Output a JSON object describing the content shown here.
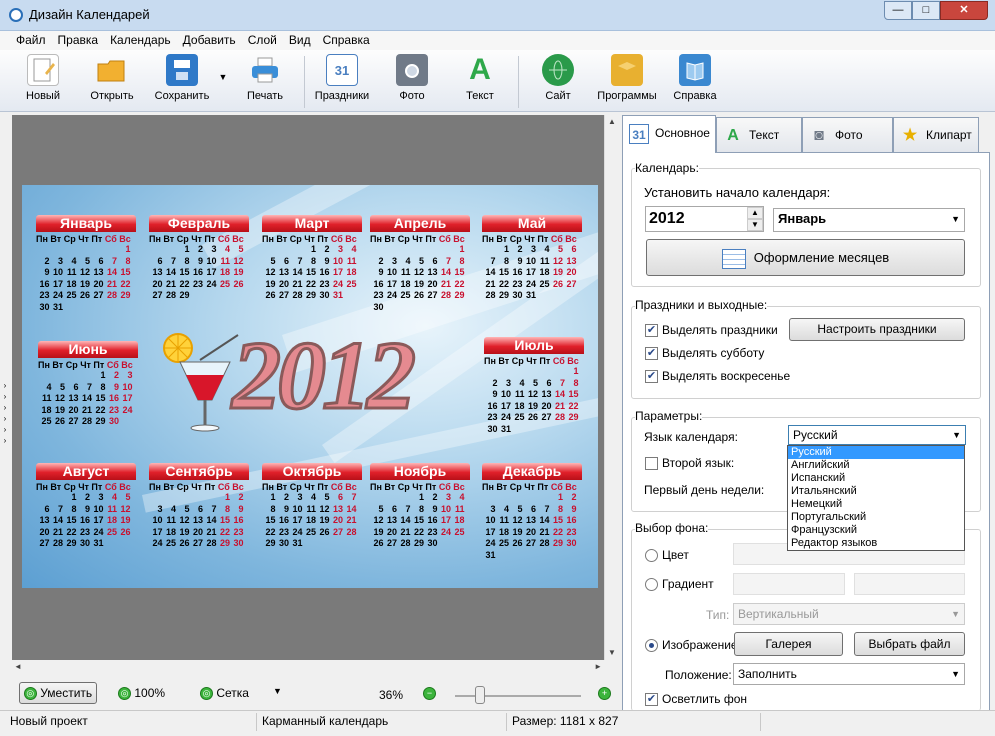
{
  "window": {
    "title": "Дизайн Календарей",
    "min": "—",
    "max": "□",
    "close": "✕"
  },
  "menu": [
    "Файл",
    "Правка",
    "Календарь",
    "Добавить",
    "Слой",
    "Вид",
    "Справка"
  ],
  "toolbar": [
    {
      "label": "Новый",
      "icon": "new-doc-icon",
      "color": "#e9b44c"
    },
    {
      "label": "Открыть",
      "icon": "folder-icon",
      "color": "#f2b030"
    },
    {
      "label": "Сохранить",
      "icon": "floppy-icon",
      "color": "#2f79c8"
    },
    {
      "label": "Печать",
      "icon": "printer-icon",
      "color": "#3a8ed8"
    },
    {
      "label": "Праздники",
      "icon": "calendar-icon",
      "color": "#4a7fc0"
    },
    {
      "label": "Фото",
      "icon": "camera-icon",
      "color": "#707a88"
    },
    {
      "label": "Текст",
      "icon": "text-a-icon",
      "color": "#2ea84a"
    },
    {
      "label": "Сайт",
      "icon": "globe-icon",
      "color": "#2a9a4a"
    },
    {
      "label": "Программы",
      "icon": "box-icon",
      "color": "#e8b030"
    },
    {
      "label": "Справка",
      "icon": "book-icon",
      "color": "#3a88d0"
    }
  ],
  "calendar": {
    "year": "2012",
    "weekdays_plain": "Пн Вт Ср Чт Пт ",
    "weekdays_red": "Сб Вс",
    "months": [
      {
        "name": "Январь",
        "rows": [
          [
            "",
            "",
            "",
            "",
            "",
            "",
            "1"
          ],
          [
            "2",
            "3",
            "4",
            "5",
            "6",
            "7",
            "8"
          ],
          [
            "9",
            "10",
            "11",
            "12",
            "13",
            "14",
            "15"
          ],
          [
            "16",
            "17",
            "18",
            "19",
            "20",
            "21",
            "22"
          ],
          [
            "23",
            "24",
            "25",
            "26",
            "27",
            "28",
            "29"
          ],
          [
            "30",
            "31",
            "",
            "",
            "",
            "",
            ""
          ]
        ]
      },
      {
        "name": "Февраль",
        "rows": [
          [
            "",
            "",
            "1",
            "2",
            "3",
            "4",
            "5"
          ],
          [
            "6",
            "7",
            "8",
            "9",
            "10",
            "11",
            "12"
          ],
          [
            "13",
            "14",
            "15",
            "16",
            "17",
            "18",
            "19"
          ],
          [
            "20",
            "21",
            "22",
            "23",
            "24",
            "25",
            "26"
          ],
          [
            "27",
            "28",
            "29",
            "",
            "",
            "",
            ""
          ]
        ]
      },
      {
        "name": "Март",
        "rows": [
          [
            "",
            "",
            "",
            "1",
            "2",
            "3",
            "4"
          ],
          [
            "5",
            "6",
            "7",
            "8",
            "9",
            "10",
            "11"
          ],
          [
            "12",
            "13",
            "14",
            "15",
            "16",
            "17",
            "18"
          ],
          [
            "19",
            "20",
            "21",
            "22",
            "23",
            "24",
            "25"
          ],
          [
            "26",
            "27",
            "28",
            "29",
            "30",
            "31",
            ""
          ]
        ]
      },
      {
        "name": "Апрель",
        "rows": [
          [
            "",
            "",
            "",
            "",
            "",
            "",
            "1"
          ],
          [
            "2",
            "3",
            "4",
            "5",
            "6",
            "7",
            "8"
          ],
          [
            "9",
            "10",
            "11",
            "12",
            "13",
            "14",
            "15"
          ],
          [
            "16",
            "17",
            "18",
            "19",
            "20",
            "21",
            "22"
          ],
          [
            "23",
            "24",
            "25",
            "26",
            "27",
            "28",
            "29"
          ],
          [
            "30",
            "",
            "",
            "",
            "",
            "",
            ""
          ]
        ]
      },
      {
        "name": "Май",
        "rows": [
          [
            "",
            "1",
            "2",
            "3",
            "4",
            "5",
            "6"
          ],
          [
            "7",
            "8",
            "9",
            "10",
            "11",
            "12",
            "13"
          ],
          [
            "14",
            "15",
            "16",
            "17",
            "18",
            "19",
            "20"
          ],
          [
            "21",
            "22",
            "23",
            "24",
            "25",
            "26",
            "27"
          ],
          [
            "28",
            "29",
            "30",
            "31",
            "",
            "",
            ""
          ]
        ]
      },
      {
        "name": "Июнь",
        "rows": [
          [
            "",
            "",
            "",
            "",
            "1",
            "2",
            "3"
          ],
          [
            "4",
            "5",
            "6",
            "7",
            "8",
            "9",
            "10"
          ],
          [
            "11",
            "12",
            "13",
            "14",
            "15",
            "16",
            "17"
          ],
          [
            "18",
            "19",
            "20",
            "21",
            "22",
            "23",
            "24"
          ],
          [
            "25",
            "26",
            "27",
            "28",
            "29",
            "30",
            ""
          ]
        ]
      },
      {
        "name": "Июль",
        "rows": [
          [
            "",
            "",
            "",
            "",
            "",
            "",
            "1"
          ],
          [
            "2",
            "3",
            "4",
            "5",
            "6",
            "7",
            "8"
          ],
          [
            "9",
            "10",
            "11",
            "12",
            "13",
            "14",
            "15"
          ],
          [
            "16",
            "17",
            "18",
            "19",
            "20",
            "21",
            "22"
          ],
          [
            "23",
            "24",
            "25",
            "26",
            "27",
            "28",
            "29"
          ],
          [
            "30",
            "31",
            "",
            "",
            "",
            "",
            ""
          ]
        ]
      },
      {
        "name": "Август",
        "rows": [
          [
            "",
            "",
            "1",
            "2",
            "3",
            "4",
            "5"
          ],
          [
            "6",
            "7",
            "8",
            "9",
            "10",
            "11",
            "12"
          ],
          [
            "13",
            "14",
            "15",
            "16",
            "17",
            "18",
            "19"
          ],
          [
            "20",
            "21",
            "22",
            "23",
            "24",
            "25",
            "26"
          ],
          [
            "27",
            "28",
            "29",
            "30",
            "31",
            "",
            ""
          ]
        ]
      },
      {
        "name": "Сентябрь",
        "rows": [
          [
            "",
            "",
            "",
            "",
            "",
            "1",
            "2"
          ],
          [
            "3",
            "4",
            "5",
            "6",
            "7",
            "8",
            "9"
          ],
          [
            "10",
            "11",
            "12",
            "13",
            "14",
            "15",
            "16"
          ],
          [
            "17",
            "18",
            "19",
            "20",
            "21",
            "22",
            "23"
          ],
          [
            "24",
            "25",
            "26",
            "27",
            "28",
            "29",
            "30"
          ]
        ]
      },
      {
        "name": "Октябрь",
        "rows": [
          [
            "1",
            "2",
            "3",
            "4",
            "5",
            "6",
            "7"
          ],
          [
            "8",
            "9",
            "10",
            "11",
            "12",
            "13",
            "14"
          ],
          [
            "15",
            "16",
            "17",
            "18",
            "19",
            "20",
            "21"
          ],
          [
            "22",
            "23",
            "24",
            "25",
            "26",
            "27",
            "28"
          ],
          [
            "29",
            "30",
            "31",
            "",
            "",
            "",
            ""
          ]
        ]
      },
      {
        "name": "Ноябрь",
        "rows": [
          [
            "",
            "",
            "",
            "1",
            "2",
            "3",
            "4"
          ],
          [
            "5",
            "6",
            "7",
            "8",
            "9",
            "10",
            "11"
          ],
          [
            "12",
            "13",
            "14",
            "15",
            "16",
            "17",
            "18"
          ],
          [
            "19",
            "20",
            "21",
            "22",
            "23",
            "24",
            "25"
          ],
          [
            "26",
            "27",
            "28",
            "29",
            "30",
            "",
            ""
          ]
        ]
      },
      {
        "name": "Декабрь",
        "rows": [
          [
            "",
            "",
            "",
            "",
            "",
            "1",
            "2"
          ],
          [
            "3",
            "4",
            "5",
            "6",
            "7",
            "8",
            "9"
          ],
          [
            "10",
            "11",
            "12",
            "13",
            "14",
            "15",
            "16"
          ],
          [
            "17",
            "18",
            "19",
            "20",
            "21",
            "22",
            "23"
          ],
          [
            "24",
            "25",
            "26",
            "27",
            "28",
            "29",
            "30"
          ],
          [
            "31",
            "",
            "",
            "",
            "",
            "",
            ""
          ]
        ]
      }
    ]
  },
  "tabs": [
    {
      "label": "Основное",
      "icon": "calendar-small-icon"
    },
    {
      "label": "Текст",
      "icon": "text-a-icon"
    },
    {
      "label": "Фото",
      "icon": "camera-icon"
    },
    {
      "label": "Клипарт",
      "icon": "star-icon"
    }
  ],
  "panel": {
    "calendar_group": "Календарь:",
    "set_start": "Установить начало календаря:",
    "year_value": "2012",
    "month_value": "Январь",
    "months_design_button": "Оформление месяцев",
    "holidays_group": "Праздники и выходные:",
    "highlight_holidays": "Выделять праздники",
    "configure_holidays": "Настроить праздники",
    "highlight_saturday": "Выделять субботу",
    "highlight_sunday": "Выделять воскресенье",
    "params_group": "Параметры:",
    "lang_label": "Язык календаря:",
    "lang_value": "Русский",
    "second_lang": "Второй язык:",
    "first_day": "Первый день недели:",
    "bg_group": "Выбор фона:",
    "color": "Цвет",
    "gradient": "Градиент",
    "type_label": "Тип:",
    "type_value": "Вертикальный",
    "image": "Изображение",
    "gallery": "Галерея",
    "choose_file": "Выбрать файл",
    "position_label": "Положение:",
    "position_value": "Заполнить",
    "lighten_bg": "Осветлить фон"
  },
  "language_options": [
    "Русский",
    "Английский",
    "Испанский",
    "Итальянский",
    "Немецкий",
    "Португальский",
    "Французский",
    "Редактор языков"
  ],
  "bottom": {
    "fit": "Уместить",
    "zoom100": "100%",
    "grid": "Сетка",
    "zoom": "36%"
  },
  "status": {
    "project": "Новый проект",
    "type": "Карманный календарь",
    "size": "Размер: 1181 x 827"
  }
}
